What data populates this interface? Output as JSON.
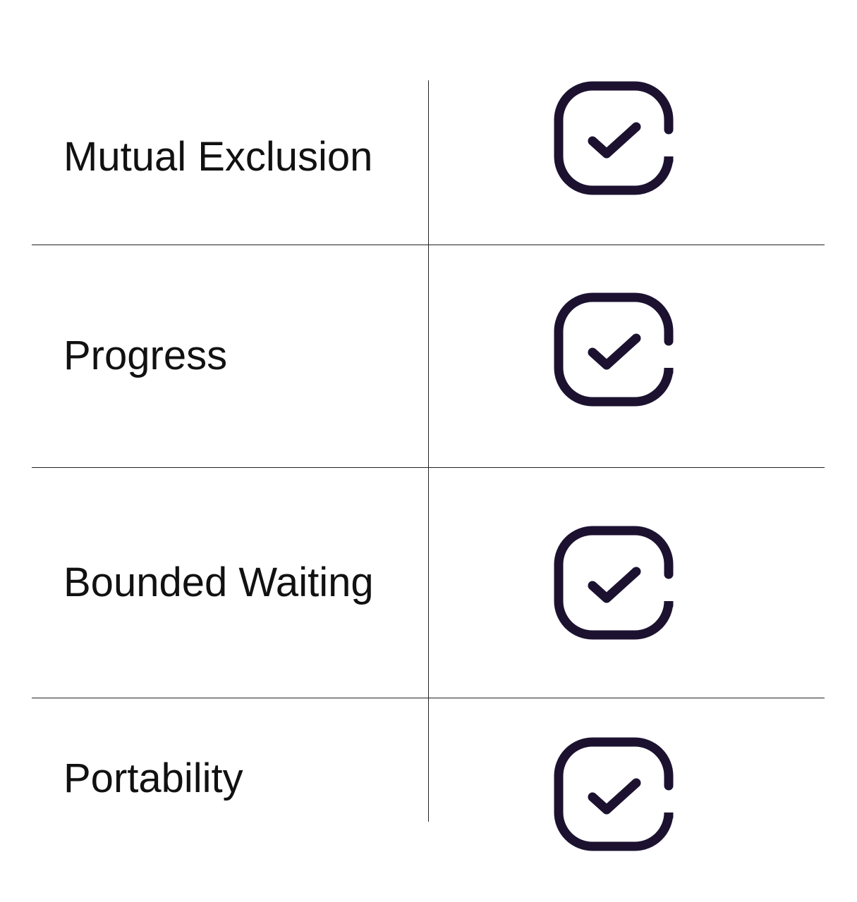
{
  "rows": [
    {
      "label": "Mutual Exclusion",
      "icon": "checkbox-checked-icon"
    },
    {
      "label": "Progress",
      "icon": "checkbox-checked-icon"
    },
    {
      "label": "Bounded Waiting",
      "icon": "checkbox-checked-icon"
    },
    {
      "label": "Portability",
      "icon": "checkbox-checked-icon"
    }
  ],
  "colors": {
    "icon_stroke": "#1c1230",
    "grid_line": "#222222",
    "text": "#111111"
  }
}
